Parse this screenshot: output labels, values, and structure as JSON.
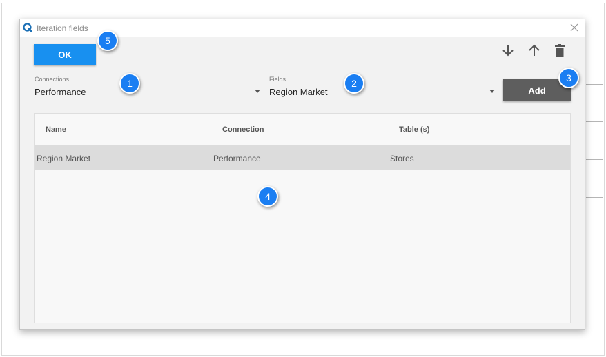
{
  "dialog": {
    "title": "Iteration fields",
    "ok_label": "OK",
    "add_label": "Add"
  },
  "connections": {
    "label": "Connections",
    "value": "Performance"
  },
  "fields": {
    "label": "Fields",
    "value": "Region Market"
  },
  "table": {
    "columns": [
      "Name",
      "Connection",
      "Table (s)"
    ],
    "rows": [
      [
        "Region Market",
        "Performance",
        "Stores"
      ]
    ]
  },
  "callouts": [
    "1",
    "2",
    "3",
    "4",
    "5"
  ],
  "icons": {
    "app": "qlik-logo-icon",
    "close": "close-icon",
    "move_down": "arrow-down-icon",
    "move_up": "arrow-up-icon",
    "delete": "trash-icon"
  },
  "colors": {
    "primary": "#1890f0",
    "add_button": "#5e5e5e",
    "badge": "#1a7ef2",
    "selected_row": "#dcdcdc"
  }
}
